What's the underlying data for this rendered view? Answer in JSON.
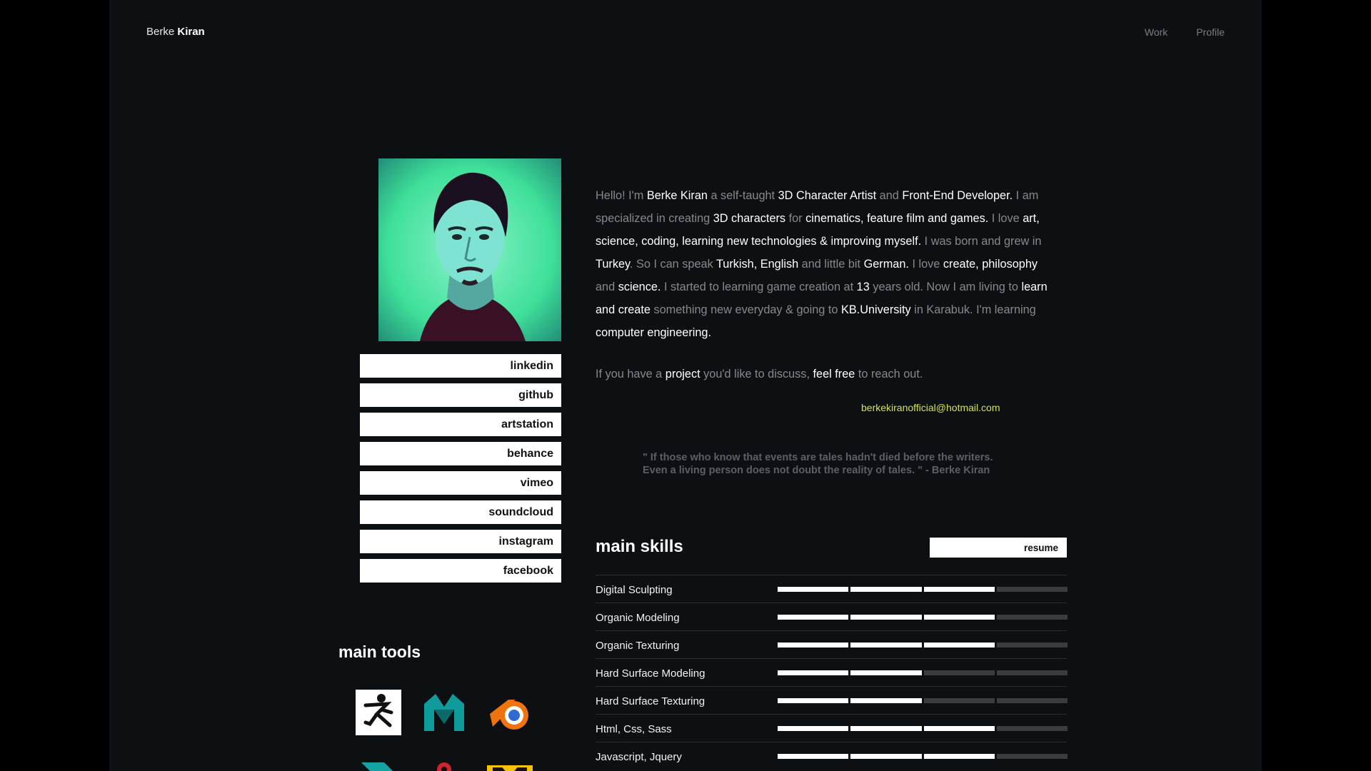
{
  "brand": {
    "first": "Berke",
    "last": "Kiran"
  },
  "nav": [
    {
      "label": "Work"
    },
    {
      "label": "Profile"
    }
  ],
  "social": [
    "linkedin",
    "github",
    "artstation",
    "behance",
    "vimeo",
    "soundcloud",
    "instagram",
    "facebook"
  ],
  "bio": {
    "p1": [
      {
        "t": "Hello! I'm ",
        "w": false
      },
      {
        "t": "Berke Kiran",
        "w": true
      },
      {
        "t": " a self-taught ",
        "w": false
      },
      {
        "t": "3D Character Artist",
        "w": true
      },
      {
        "t": " and ",
        "w": false
      },
      {
        "t": "Front-End Developer.",
        "w": true
      },
      {
        "t": " I am specialized in creating ",
        "w": false
      },
      {
        "t": "3D characters",
        "w": true
      },
      {
        "t": " for ",
        "w": false
      },
      {
        "t": "cinematics, feature film and games.",
        "w": true
      },
      {
        "t": " I love ",
        "w": false
      },
      {
        "t": "art, science, coding, learning new technologies & improving myself.",
        "w": true
      },
      {
        "t": " I was born and grew in ",
        "w": false
      },
      {
        "t": "Turkey",
        "w": true
      },
      {
        "t": ". So I can speak ",
        "w": false
      },
      {
        "t": "Turkish, English",
        "w": true
      },
      {
        "t": " and little bit ",
        "w": false
      },
      {
        "t": "German.",
        "w": true
      },
      {
        "t": " I love ",
        "w": false
      },
      {
        "t": "create, philosophy",
        "w": true
      },
      {
        "t": " and ",
        "w": false
      },
      {
        "t": "science.",
        "w": true
      },
      {
        "t": " I started to learning game creation at ",
        "w": false
      },
      {
        "t": "13",
        "w": true
      },
      {
        "t": " years old. Now I am living to ",
        "w": false
      },
      {
        "t": "learn and create",
        "w": true
      },
      {
        "t": " something new everyday & going to ",
        "w": false
      },
      {
        "t": "KB.University",
        "w": true
      },
      {
        "t": " in Karabuk. I'm learning ",
        "w": false
      },
      {
        "t": "computer engineering.",
        "w": true
      }
    ],
    "p2": [
      {
        "t": "If you have a ",
        "w": false
      },
      {
        "t": "project",
        "w": true
      },
      {
        "t": " you'd like to discuss, ",
        "w": false
      },
      {
        "t": "feel free",
        "w": true
      },
      {
        "t": " to reach out.",
        "w": false
      }
    ]
  },
  "email": "berkekiranofficial@hotmail.com",
  "quote": {
    "line1": "\" If those who know that events are tales hadn't died before the writers.",
    "line2": "Even a living person does not doubt the reality of tales. \" - Berke Kiran"
  },
  "skills_title": "main skills",
  "resume_label": "resume",
  "skills": [
    {
      "label": "Digital Sculpting",
      "level": 3,
      "max": 4
    },
    {
      "label": "Organic Modeling",
      "level": 3,
      "max": 4
    },
    {
      "label": "Organic Texturing",
      "level": 3,
      "max": 4
    },
    {
      "label": "Hard Surface Modeling",
      "level": 2,
      "max": 4
    },
    {
      "label": "Hard Surface Texturing",
      "level": 2,
      "max": 4
    },
    {
      "label": "Html, Css, Sass",
      "level": 3,
      "max": 4
    },
    {
      "label": "Javascript, Jquery",
      "level": 3,
      "max": 4
    }
  ],
  "tools_title": "main tools",
  "tools": [
    "zbrush-icon",
    "maya-icon",
    "blender-icon",
    "3dsmax-icon",
    "substance-icon",
    "marmoset-icon"
  ],
  "colors": {
    "background": "#0d1013",
    "accent_email": "#d4e157"
  }
}
